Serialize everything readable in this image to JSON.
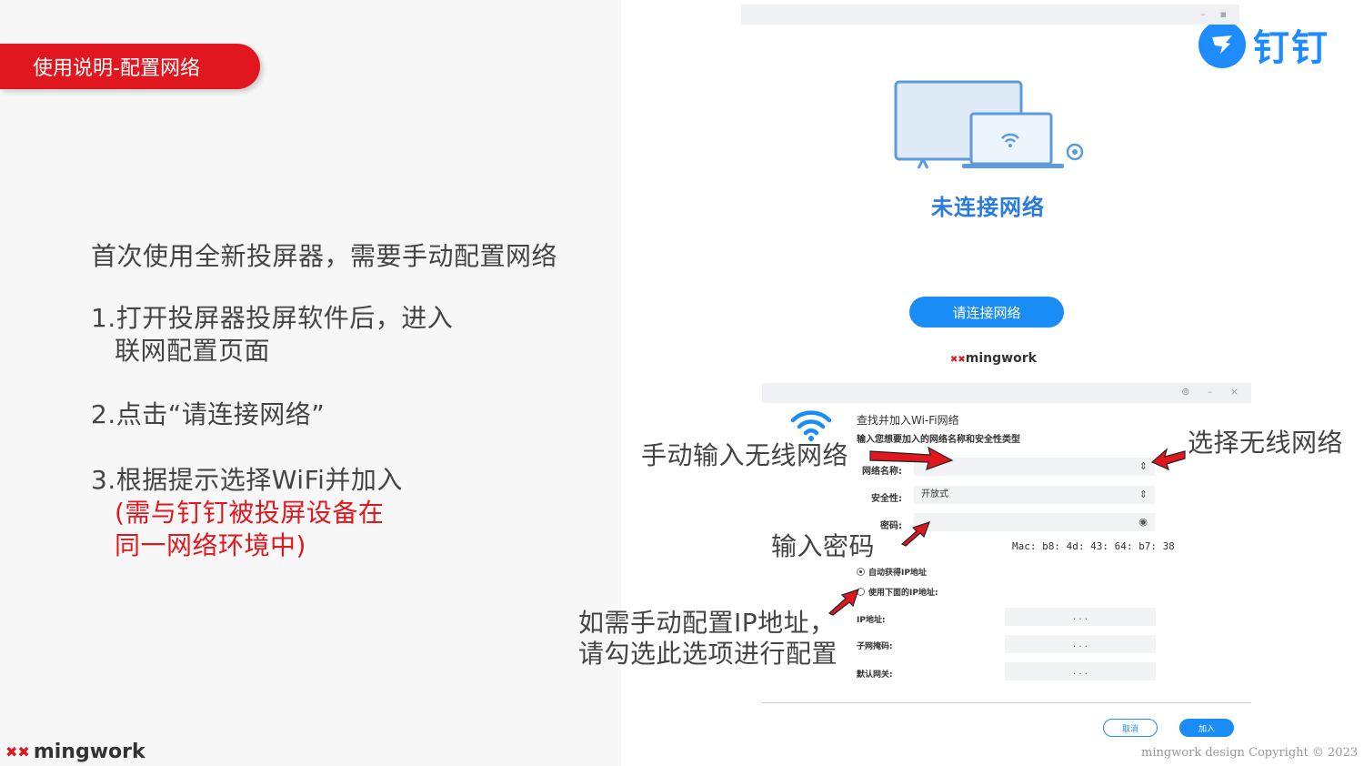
{
  "left": {
    "title_tag": "使用说明-配置网络",
    "intro": "首次使用全新投屏器，需要手动配置网络",
    "step1_line1": "1.打开投屏器投屏软件后，进入",
    "step1_line2": "联网配置页面",
    "step2": "2.点击“请连接网络”",
    "step3_line1": "3.根据提示选择WiFi并加入",
    "step3_note1": "(需与钉钉被投屏设备在",
    "step3_note2": "同一网络环境中)",
    "brand": "mingwork"
  },
  "logo": {
    "text": "钉钉",
    "color": "#1e8cff"
  },
  "top_screen": {
    "status_title": "未连接网络",
    "connect_button": "请连接网络",
    "brand": "mingwork"
  },
  "dialog": {
    "title": "查找并加入Wi-Fi网络",
    "subtitle": "输入您想要加入的网络名称和安全性类型",
    "network_name_label": "网络名称:",
    "network_name_value": "",
    "security_label": "安全性:",
    "security_value": "开放式",
    "password_label": "密码:",
    "password_value": "",
    "mac": "Mac: b8: 4d: 43: 64: b7: 38",
    "radio_auto": "自动获得IP地址",
    "radio_manual": "使用下面的IP地址:",
    "ip_label": "IP地址:",
    "mask_label": "子网掩码:",
    "gateway_label": "默认网关:",
    "ip_placeholder": ". . .",
    "cancel_button": "取消",
    "join_button": "加入"
  },
  "annotations": {
    "manual_input": "手动输入无线网络",
    "select_network": "选择无线网络",
    "enter_password": "输入密码",
    "manual_ip_line1": "如需手动配置IP地址，",
    "manual_ip_line2": "请勾选此选项进行配置"
  },
  "copyright": "mingwork design Copyright © 2023",
  "colors": {
    "accent_red": "#e0171e",
    "accent_blue": "#1a8cf5"
  }
}
